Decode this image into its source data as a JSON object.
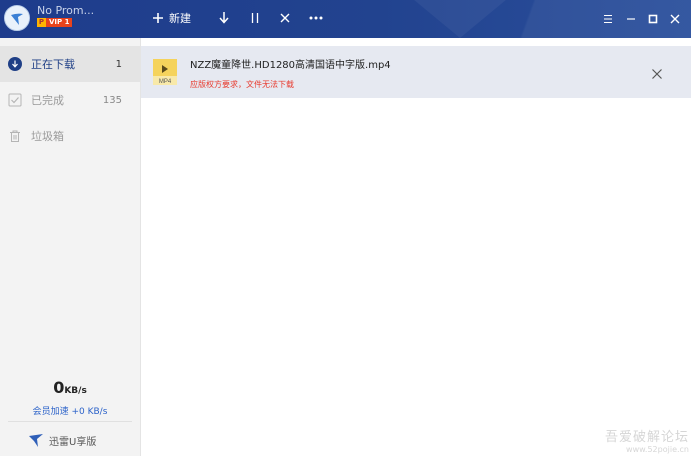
{
  "titlebar": {
    "username": "No Prom...",
    "vip_badge_p": "P",
    "vip_badge_text": "VIP 1",
    "new_label": "新建",
    "icons": {
      "new": "plus-icon",
      "download": "arrow-down-icon",
      "pause": "pause-icon",
      "delete": "close-icon",
      "more": "more-dots-icon",
      "menu": "hamburger-menu-icon",
      "minimize": "minimize-icon",
      "maximize": "maximize-icon",
      "close": "window-close-icon"
    }
  },
  "sidebar": {
    "items": [
      {
        "label": "正在下载",
        "count": "1",
        "icon": "download-circle-icon"
      },
      {
        "label": "已完成",
        "count": "135",
        "icon": "checkbox-icon"
      },
      {
        "label": "垃圾箱",
        "count": "",
        "icon": "trash-icon"
      }
    ],
    "speed_value": "0",
    "speed_unit": "KB/s",
    "speed_sub": "会员加速 +0 KB/s",
    "udisk_label": "迅雷U享版"
  },
  "tasks": [
    {
      "file_name": "NZZ魔童降世.HD1280高清国语中字版.mp4",
      "file_ext": "MP4",
      "status": "应版权方要求，文件无法下载",
      "icon": "video-file-icon"
    }
  ],
  "watermark": {
    "line1": "吾爱破解论坛",
    "line2": "www.52pojie.cn"
  },
  "colors": {
    "titlebar": "#1e3c8c",
    "sidebar_bg": "#f3f3f3",
    "active_item": "#1f3f86",
    "error": "#e83b2f",
    "selected_row": "#e6e9f1"
  }
}
